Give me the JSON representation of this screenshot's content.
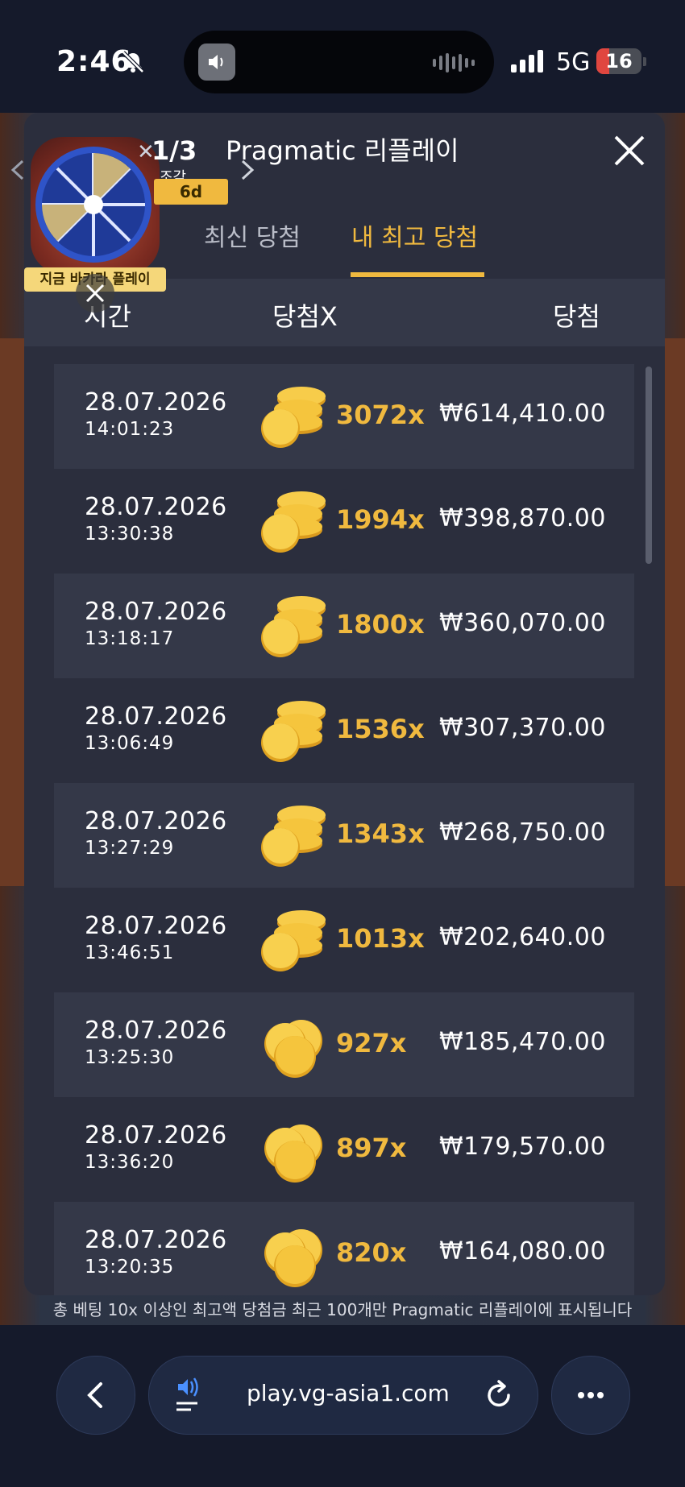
{
  "status_bar": {
    "time": "2:46",
    "network": "5G",
    "battery": "16"
  },
  "promo": {
    "counter": "1/3",
    "unit": "조각",
    "days": "6d",
    "label": "지금 바카라 플레이"
  },
  "panel": {
    "title": "Pragmatic 리플레이",
    "tabs": [
      {
        "label": "최신 당첨",
        "active": false
      },
      {
        "label": "내 최고 당첨",
        "active": true
      }
    ],
    "columns": {
      "time": "시간",
      "multiplier": "당첨X",
      "win": "당첨"
    },
    "rows": [
      {
        "date": "28.07.2026",
        "time": "14:01:23",
        "multiplier": "3072x",
        "win": "₩614,410.00",
        "coin": "stack"
      },
      {
        "date": "28.07.2026",
        "time": "13:30:38",
        "multiplier": "1994x",
        "win": "₩398,870.00",
        "coin": "stack"
      },
      {
        "date": "28.07.2026",
        "time": "13:18:17",
        "multiplier": "1800x",
        "win": "₩360,070.00",
        "coin": "stack"
      },
      {
        "date": "28.07.2026",
        "time": "13:06:49",
        "multiplier": "1536x",
        "win": "₩307,370.00",
        "coin": "stack"
      },
      {
        "date": "28.07.2026",
        "time": "13:27:29",
        "multiplier": "1343x",
        "win": "₩268,750.00",
        "coin": "stack"
      },
      {
        "date": "28.07.2026",
        "time": "13:46:51",
        "multiplier": "1013x",
        "win": "₩202,640.00",
        "coin": "stack"
      },
      {
        "date": "28.07.2026",
        "time": "13:25:30",
        "multiplier": "927x",
        "win": "₩185,470.00",
        "coin": "pile"
      },
      {
        "date": "28.07.2026",
        "time": "13:36:20",
        "multiplier": "897x",
        "win": "₩179,570.00",
        "coin": "pile"
      },
      {
        "date": "28.07.2026",
        "time": "13:20:35",
        "multiplier": "820x",
        "win": "₩164,080.00",
        "coin": "pile"
      }
    ],
    "footnote": "총 베팅 10x 이상인 최고액 당첨금 최근 100개만 Pragmatic 리플레이에 표시됩니다"
  },
  "browser": {
    "url": "play.vg-asia1.com"
  },
  "colors": {
    "accent": "#f0b93f",
    "panel": "#2b2e3d",
    "row_dark": "#343848",
    "background": "#151a2b"
  }
}
